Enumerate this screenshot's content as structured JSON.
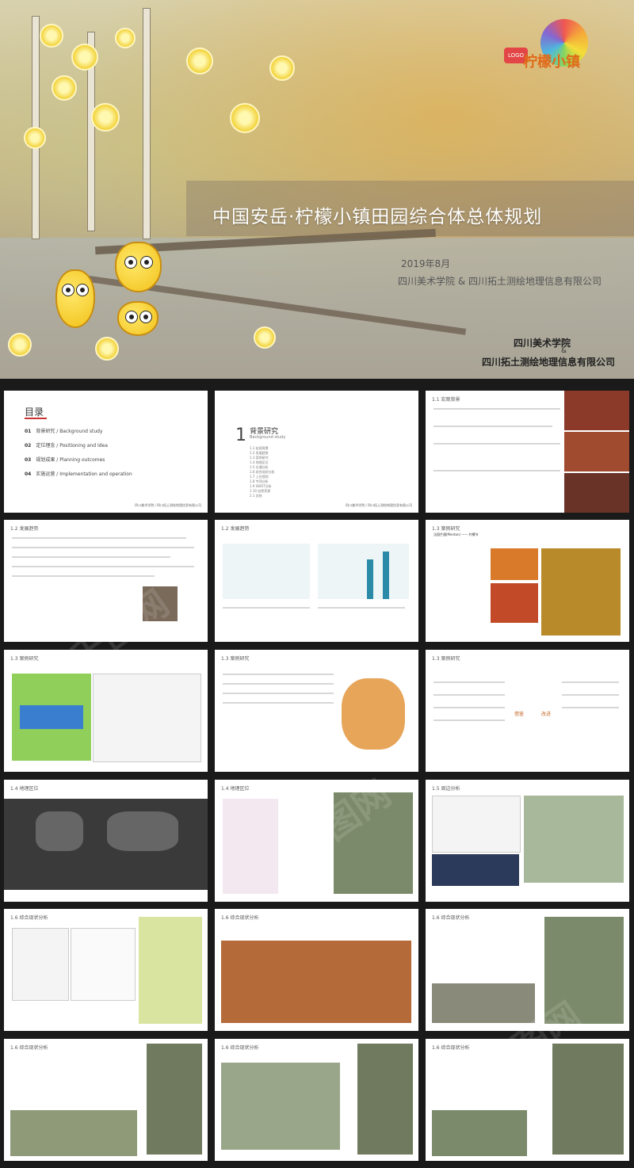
{
  "cover": {
    "title": "中国安岳·柠檬小镇田园综合体总体规划",
    "date": "2019年8月",
    "organization": "四川美术学院 & 四川拓土测绘地理信息有限公司",
    "client_line1": "四川美术学院",
    "amp": "&",
    "client_line2": "四川拓土测绘地理信息有限公司",
    "logo_text": "柠檬小镇"
  },
  "toc": {
    "heading": "目录",
    "items": [
      {
        "num": "01",
        "label": "背景研究 / Background study"
      },
      {
        "num": "02",
        "label": "定位理念 / Positioning and Idea"
      },
      {
        "num": "03",
        "label": "规划成果 / Planning outcomes"
      },
      {
        "num": "04",
        "label": "实施运营 / Implementation and operation"
      }
    ],
    "footer": "四川美术学院 / 四川拓土测绘地理信息有限公司"
  },
  "section1": {
    "number": "1",
    "title": "背景研究",
    "subtitle": "Background study",
    "items": [
      "1.1 宏观背景",
      "1.2 发展趋势",
      "1.3 案例研究",
      "1.4 地理区位",
      "1.5 交通分析",
      "1.6 综合现状分析",
      "1.7 上位规划",
      "1.8 专项分析",
      "1.9 SWOT分析",
      "1.10 自然资源",
      "2.1 总结"
    ],
    "footer": "四川美术学院 / 四川拓土测绘地理信息有限公司"
  },
  "slides": [
    {
      "title": "1.1 宏观背景"
    },
    {
      "title": "1.2 发展趋势"
    },
    {
      "title": "1.2 发展趋势"
    },
    {
      "title": "1.3 案例研究"
    },
    {
      "title": "1.3 案例研究"
    },
    {
      "title": "1.3 案例研究"
    },
    {
      "title": "1.3 案例研究"
    },
    {
      "title": "1.4 地理区位"
    },
    {
      "title": "1.4 地理区位"
    },
    {
      "title": "1.5 周边分析"
    },
    {
      "title": "1.6 综合现状分析"
    },
    {
      "title": "1.6 综合现状分析"
    },
    {
      "title": "1.6 综合现状分析"
    },
    {
      "title": "1.6 综合现状分析"
    },
    {
      "title": "1.6 综合现状分析"
    },
    {
      "title": "1.6 综合现状分析"
    }
  ],
  "case_summary": {
    "left": "借鉴",
    "right": "改进"
  },
  "mentions": {
    "menton": "法国芒通(Menton) —— 柠檬节",
    "footer": "四川美术学院"
  },
  "watermarks": [
    "千图网",
    "千图网",
    "千图网"
  ]
}
